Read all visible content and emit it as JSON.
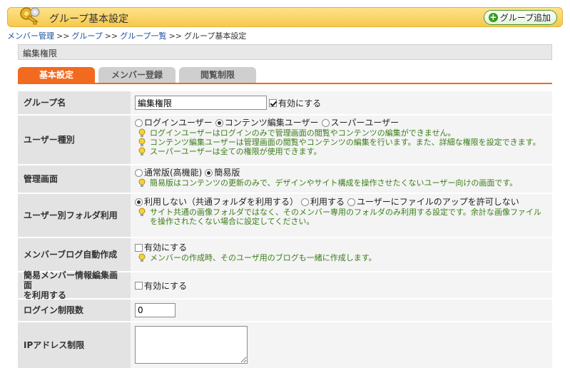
{
  "header": {
    "title": "グループ基本設定",
    "add_button": "グループ追加"
  },
  "breadcrumb": {
    "items": [
      "メンバー管理",
      "グループ",
      "グループ一覧"
    ],
    "separator": ">>",
    "current": "グループ基本設定"
  },
  "section": {
    "title": "編集権限"
  },
  "tabs": [
    {
      "label": "基本設定",
      "active": true
    },
    {
      "label": "メンバー登録",
      "active": false
    },
    {
      "label": "閲覧制限",
      "active": false
    }
  ],
  "form": {
    "group_name": {
      "label": "グループ名",
      "value": "編集権限",
      "enable_label": "有効にする",
      "enabled": true
    },
    "user_type": {
      "label": "ユーザー種別",
      "options": [
        "ログインユーザー",
        "コンテンツ編集ユーザー",
        "スーパーユーザー"
      ],
      "selected": 1,
      "hints": [
        "ログインユーザーはログインのみで管理画面の閲覧やコンテンツの編集ができません。",
        "コンテンツ編集ユーザーは管理画面の閲覧やコンテンツの編集を行います。また、詳細な権限を設定できます。",
        "スーパーユーザーは全ての権限が使用できます。"
      ]
    },
    "admin_screen": {
      "label": "管理画面",
      "options": [
        "通常版(高機能)",
        "簡易版"
      ],
      "selected": 1,
      "hint": "簡易版はコンテンツの更新のみで、デザインやサイト構成を操作させたくないユーザー向けの画面です。"
    },
    "user_folder": {
      "label": "ユーザー別フォルダ利用",
      "options": [
        "利用しない（共通フォルダを利用する）",
        "利用する",
        "ユーザーにファイルのアップを許可しない"
      ],
      "selected": 0,
      "hint_line1": "サイト共通の画像フォルダではなく、そのメンバー専用のフォルダのみ利用する設定です。余計な画像ファイル",
      "hint_line2": "を操作されたくない場合に設定してください。"
    },
    "member_blog": {
      "label": "メンバーブログ自動作成",
      "check_label": "有効にする",
      "checked": false,
      "hint": "メンバーの作成時、そのユーザ用のブログも一緒に作成します。"
    },
    "simple_member_edit": {
      "label_line1": "簡易メンバー情報編集画面",
      "label_line2": "を利用する",
      "check_label": "有効にする",
      "checked": false
    },
    "login_limit": {
      "label": "ログイン制限数",
      "value": "0"
    },
    "ip_limit": {
      "label": "IPアドレス制限",
      "value": ""
    }
  },
  "colors": {
    "accent": "#f26a1f",
    "header_bg": "#f9d266",
    "hint_text": "#3a7d18",
    "link": "#1a4fa0"
  }
}
